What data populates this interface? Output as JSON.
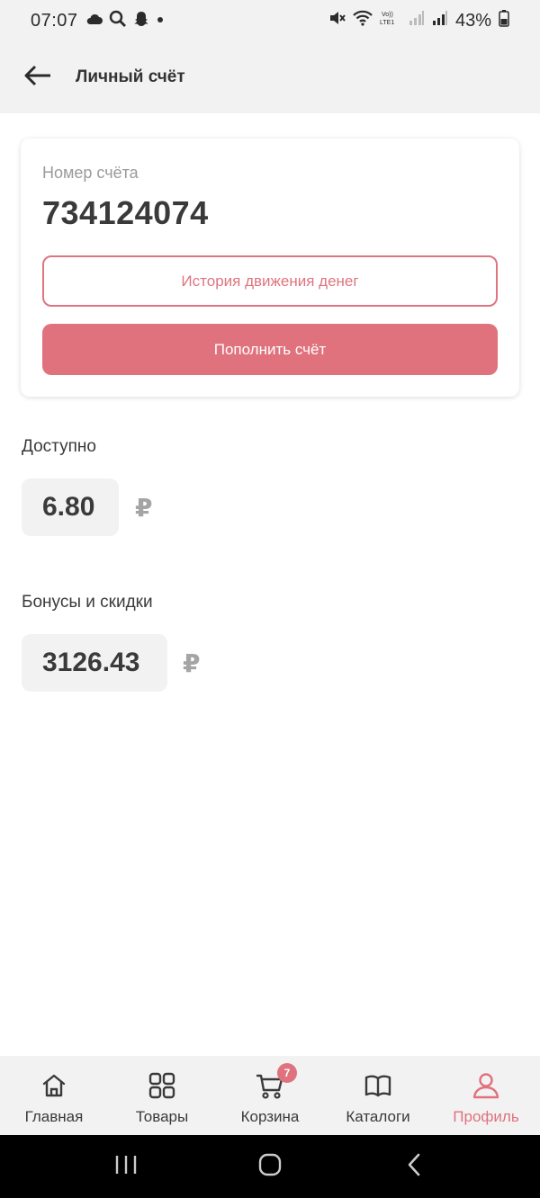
{
  "status_bar": {
    "time": "07:07",
    "battery": "43%",
    "icons": [
      "cloud-icon",
      "search-icon",
      "snapchat-icon",
      "dot-icon",
      "mute-icon",
      "wifi-icon",
      "volte-icon",
      "signal-icon",
      "signal-icon",
      "battery-icon"
    ]
  },
  "header": {
    "title": "Личный счёт"
  },
  "account": {
    "label": "Номер счёта",
    "number": "734124074",
    "history_button": "История движения денег",
    "topup_button": "Пополнить счёт"
  },
  "available": {
    "label": "Доступно",
    "amount": "6.80",
    "currency": "₽"
  },
  "bonuses": {
    "label": "Бонусы и скидки",
    "amount": "3126.43",
    "currency": "₽"
  },
  "bottom_nav": {
    "items": [
      {
        "label": "Главная",
        "icon": "home-icon"
      },
      {
        "label": "Товары",
        "icon": "grid-icon"
      },
      {
        "label": "Корзина",
        "icon": "cart-icon",
        "badge": "7"
      },
      {
        "label": "Каталоги",
        "icon": "book-icon"
      },
      {
        "label": "Профиль",
        "icon": "user-icon",
        "active": true
      }
    ]
  },
  "colors": {
    "accent": "#e0727d",
    "surface": "#f2f2f2",
    "text": "#3a3a3a",
    "muted": "#9a9a9a"
  }
}
